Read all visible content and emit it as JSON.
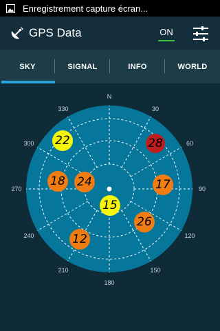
{
  "status_bar": {
    "text": "Enregistrement capture écran...",
    "icon": "image-icon"
  },
  "action_bar": {
    "title": "GPS Data",
    "app_icon": "satellite-icon",
    "toggle_label": "ON",
    "settings_icon": "sliders-icon"
  },
  "tabs": [
    {
      "label": "SKY",
      "active": true
    },
    {
      "label": "SIGNAL",
      "active": false
    },
    {
      "label": "INFO",
      "active": false
    },
    {
      "label": "WORLD",
      "active": false
    }
  ],
  "sky": {
    "north_label": "N",
    "labels": [
      "30",
      "60",
      "90",
      "120",
      "150",
      "180",
      "210",
      "240",
      "270",
      "300",
      "330"
    ],
    "satellites": [
      {
        "id": "22",
        "color": "#f5f50a",
        "text_color": "#000000"
      },
      {
        "id": "28",
        "color": "#c01e1e",
        "text_color": "#000000"
      },
      {
        "id": "18",
        "color": "#f07c14",
        "text_color": "#000000"
      },
      {
        "id": "24",
        "color": "#f07c14",
        "text_color": "#000000"
      },
      {
        "id": "17",
        "color": "#f07c14",
        "text_color": "#000000"
      },
      {
        "id": "15",
        "color": "#f5f50a",
        "text_color": "#000000"
      },
      {
        "id": "26",
        "color": "#f07c14",
        "text_color": "#000000"
      },
      {
        "id": "12",
        "color": "#f07c14",
        "text_color": "#000000"
      }
    ]
  },
  "colors": {
    "sky_disc": "#06769a",
    "background": "#0f2b38",
    "accent": "#2aa3d8",
    "toggle_underline": "#3ac43a"
  }
}
